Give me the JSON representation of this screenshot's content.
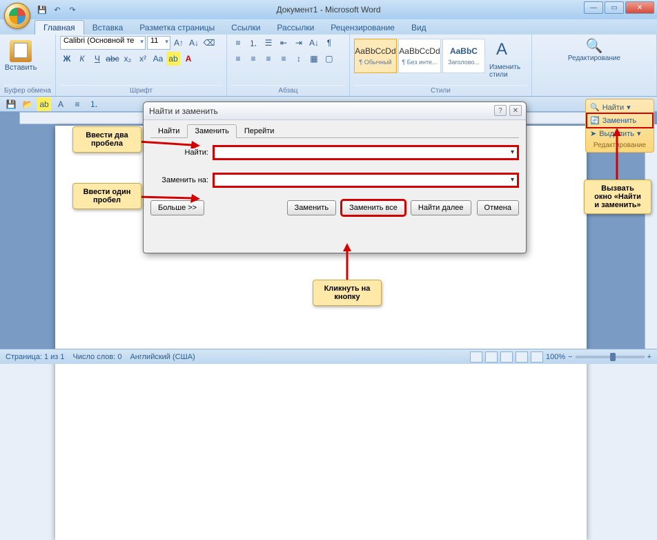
{
  "window": {
    "title": "Документ1 - Microsoft Word"
  },
  "tabs": {
    "home": "Главная",
    "insert": "Вставка",
    "layout": "Разметка страницы",
    "refs": "Ссылки",
    "mail": "Рассылки",
    "review": "Рецензирование",
    "view": "Вид"
  },
  "ribbon": {
    "clipboard": {
      "label": "Буфер обмена",
      "paste": "Вставить"
    },
    "font": {
      "label": "Шрифт",
      "name": "Calibri (Основной те",
      "size": "11"
    },
    "paragraph": {
      "label": "Абзац"
    },
    "styles": {
      "label": "Стили",
      "items": [
        {
          "preview": "AaBbCcDd",
          "name": "¶ Обычный"
        },
        {
          "preview": "AaBbCcDd",
          "name": "¶ Без инте..."
        },
        {
          "preview": "AaBbC",
          "name": "Заголово..."
        }
      ],
      "change": "Изменить стили"
    },
    "editing": {
      "label": "Редактирование",
      "find": "Найти",
      "replace": "Заменить",
      "select": "Выделить"
    }
  },
  "dialog": {
    "title": "Найти и заменить",
    "tabs": {
      "find": "Найти",
      "replace": "Заменить",
      "goto": "Перейти"
    },
    "find_label": "Найти:",
    "replace_label": "Заменить на:",
    "more": "Больше >>",
    "btn_replace": "Заменить",
    "btn_replace_all": "Заменить все",
    "btn_find_next": "Найти далее",
    "btn_cancel": "Отмена"
  },
  "callouts": {
    "two_spaces": "Ввести два пробела",
    "one_space": "Ввести один пробел",
    "click_btn": "Кликнуть на кнопку",
    "open_dialog": "Вызвать окно «Найти и заменить»"
  },
  "edit_panel_label": "Редактирование",
  "status": {
    "page": "Страница: 1 из 1",
    "words": "Число слов: 0",
    "lang": "Английский (США)",
    "zoom": "100%"
  }
}
